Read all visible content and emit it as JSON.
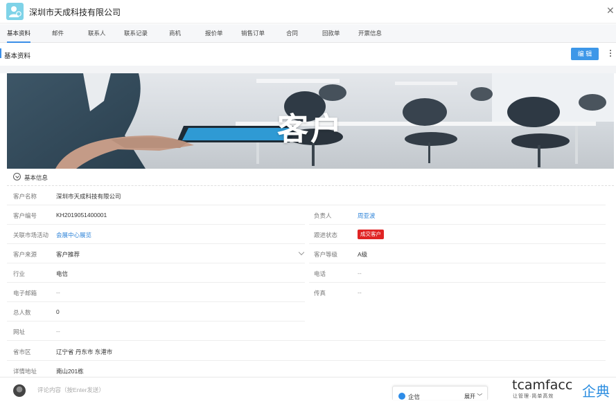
{
  "window": {
    "title": "深圳市天成科技有限公司"
  },
  "tabs": [
    {
      "label": "基本资料"
    },
    {
      "label": "邮件"
    },
    {
      "label": "联系人"
    },
    {
      "label": "联系记录"
    },
    {
      "label": "商机"
    },
    {
      "label": "报价单"
    },
    {
      "label": "销售订单"
    },
    {
      "label": "合同"
    },
    {
      "label": "回款单"
    },
    {
      "label": "开票信息"
    }
  ],
  "section": {
    "title": "基本资料",
    "edit_label": "编 辑"
  },
  "banner": {
    "title": "客户"
  },
  "group": {
    "title": "基本信息"
  },
  "fields": {
    "customer_name": {
      "label": "客户名称",
      "value": "深圳市天成科技有限公司"
    },
    "customer_no": {
      "label": "客户编号",
      "value": "KH2019051400001"
    },
    "owner": {
      "label": "负责人",
      "value": "周亚波"
    },
    "campaign": {
      "label": "关联市场活动",
      "value": "会展中心展览"
    },
    "follow_status": {
      "label": "跟进状态",
      "value": "成交客户"
    },
    "source": {
      "label": "客户来源",
      "value": "客户推荐"
    },
    "level": {
      "label": "客户等级",
      "value": "A级"
    },
    "industry": {
      "label": "行业",
      "value": "电信"
    },
    "phone": {
      "label": "电话",
      "value": "--"
    },
    "email": {
      "label": "电子邮箱",
      "value": "--"
    },
    "fax": {
      "label": "传真",
      "value": "--"
    },
    "headcount": {
      "label": "总人数",
      "value": "0"
    },
    "website": {
      "label": "网址",
      "value": "--"
    },
    "region": {
      "label": "省市区",
      "value": "辽宁省 丹东市 东港市"
    },
    "address": {
      "label": "详情地址",
      "value": "南山201栋"
    }
  },
  "comment": {
    "placeholder": "评论内容（按Enter发送）"
  },
  "chat": {
    "label": "企信",
    "expand": "展开"
  },
  "brand": {
    "en": "tcamfacc",
    "cn": "企典",
    "slogan": "让管理·简单高效"
  },
  "colors": {
    "accent": "#3b8fe8",
    "badge": "#e02424",
    "link": "#2f84d8"
  }
}
